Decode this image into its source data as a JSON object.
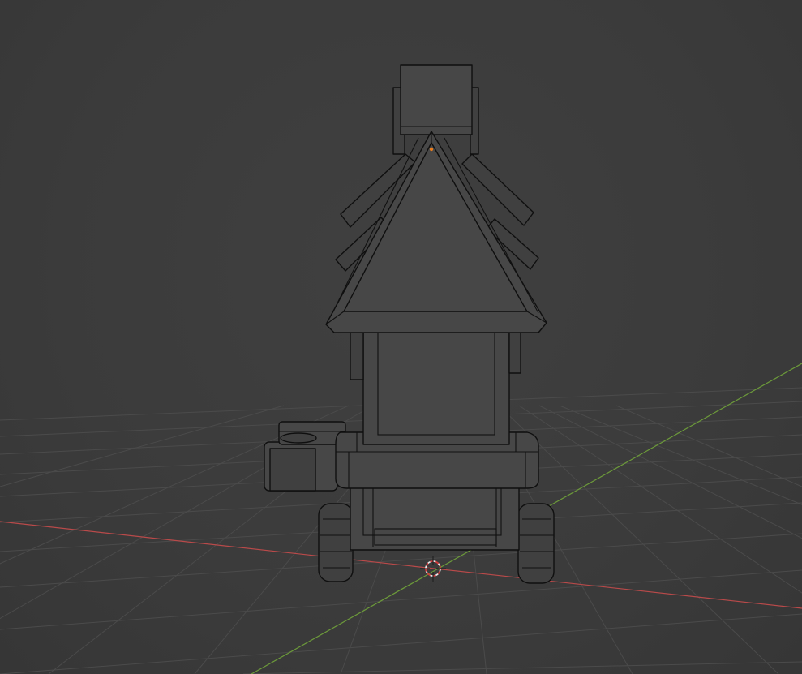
{
  "viewport": {
    "background": "#3d3d3d",
    "grid_color": "#4b4b4b",
    "x_axis_color": "#b94a4a",
    "y_axis_color": "#6c9a3a",
    "mesh_fill": "#474747",
    "mesh_wire": "#0f0f0f",
    "origin_color": "#e87d1e"
  },
  "scene": {
    "object": "wagon-stall-model",
    "shading": "solid-wireframe",
    "cursor": "3d-cursor-icon"
  }
}
